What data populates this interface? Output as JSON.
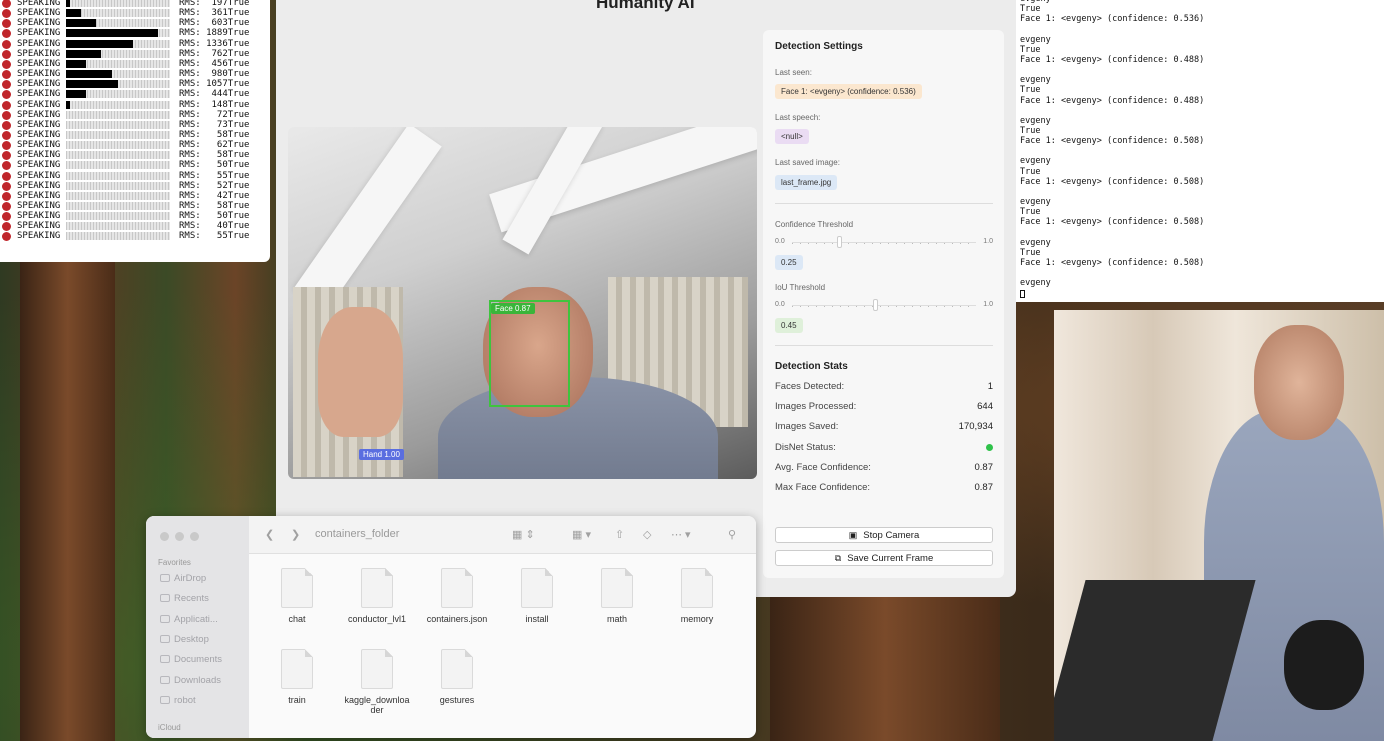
{
  "terminal_left": {
    "rows": [
      {
        "label": "SPEAKING",
        "rms": "RMS:  197True",
        "level": 0.04
      },
      {
        "label": "SPEAKING",
        "rms": "RMS:  361True",
        "level": 0.14
      },
      {
        "label": "SPEAKING",
        "rms": "RMS:  603True",
        "level": 0.29
      },
      {
        "label": "SPEAKING",
        "rms": "RMS: 1889True",
        "level": 0.88
      },
      {
        "label": "SPEAKING",
        "rms": "RMS: 1336True",
        "level": 0.64
      },
      {
        "label": "SPEAKING",
        "rms": "RMS:  762True",
        "level": 0.34
      },
      {
        "label": "SPEAKING",
        "rms": "RMS:  456True",
        "level": 0.19
      },
      {
        "label": "SPEAKING",
        "rms": "RMS:  980True",
        "level": 0.44
      },
      {
        "label": "SPEAKING",
        "rms": "RMS: 1057True",
        "level": 0.5
      },
      {
        "label": "SPEAKING",
        "rms": "RMS:  444True",
        "level": 0.19
      },
      {
        "label": "SPEAKING",
        "rms": "RMS:  148True",
        "level": 0.04
      },
      {
        "label": "SPEAKING",
        "rms": "RMS:   72True",
        "level": 0
      },
      {
        "label": "SPEAKING",
        "rms": "RMS:   73True",
        "level": 0
      },
      {
        "label": "SPEAKING",
        "rms": "RMS:   58True",
        "level": 0
      },
      {
        "label": "SPEAKING",
        "rms": "RMS:   62True",
        "level": 0
      },
      {
        "label": "SPEAKING",
        "rms": "RMS:   58True",
        "level": 0
      },
      {
        "label": "SPEAKING",
        "rms": "RMS:   50True",
        "level": 0
      },
      {
        "label": "SPEAKING",
        "rms": "RMS:   55True",
        "level": 0
      },
      {
        "label": "SPEAKING",
        "rms": "RMS:   52True",
        "level": 0
      },
      {
        "label": "SPEAKING",
        "rms": "RMS:   42True",
        "level": 0
      },
      {
        "label": "SPEAKING",
        "rms": "RMS:   58True",
        "level": 0
      },
      {
        "label": "SPEAKING",
        "rms": "RMS:   50True",
        "level": 0
      },
      {
        "label": "SPEAKING",
        "rms": "RMS:   40True",
        "level": 0
      },
      {
        "label": "SPEAKING",
        "rms": "RMS:   55True",
        "level": 0
      }
    ]
  },
  "app": {
    "title": "Humanity AI"
  },
  "video": {
    "face_label": "Face 0.87",
    "hand_label": "Hand 1.00"
  },
  "settings": {
    "heading": "Detection Settings",
    "last_seen_label": "Last seen:",
    "last_seen_value": "Face 1: <evgeny> (confidence: 0.536)",
    "last_speech_label": "Last speech:",
    "last_speech_value": "<null>",
    "last_saved_label": "Last saved image:",
    "last_saved_value": "last_frame.jpg",
    "conf_label": "Confidence Threshold",
    "conf_min": "0.0",
    "conf_max": "1.0",
    "conf_value": "0.25",
    "iou_label": "IoU Threshold",
    "iou_min": "0.0",
    "iou_max": "1.0",
    "iou_value": "0.45",
    "stats_heading": "Detection Stats",
    "stats": [
      {
        "label": "Faces Detected:",
        "value": "1"
      },
      {
        "label": "Images Processed:",
        "value": "644"
      },
      {
        "label": "Images Saved:",
        "value": "170,934"
      },
      {
        "label": "DisNet Status:",
        "value": ""
      },
      {
        "label": "Avg. Face Confidence:",
        "value": "0.87"
      },
      {
        "label": "Max Face Confidence:",
        "value": "0.87"
      }
    ],
    "stop_camera": "Stop Camera",
    "save_frame": "Save Current Frame"
  },
  "finder": {
    "title": "containers_folder",
    "favorites_heading": "Favorites",
    "sidebar": [
      "AirDrop",
      "Recents",
      "Applicati...",
      "Desktop",
      "Documents",
      "Downloads",
      "robot"
    ],
    "icloud_heading": "iCloud",
    "files": [
      "chat",
      "conductor_lvl1",
      "containers.json",
      "install",
      "math",
      "memory",
      "train",
      "kaggle_downloader",
      "gestures"
    ]
  },
  "terminal_right": {
    "lines": [
      "evgeny",
      "True",
      "Face 1: <evgeny> (confidence: 0.536)",
      "",
      "evgeny",
      "True",
      "Face 1: <evgeny> (confidence: 0.488)",
      "",
      "evgeny",
      "True",
      "Face 1: <evgeny> (confidence: 0.488)",
      "",
      "evgeny",
      "True",
      "Face 1: <evgeny> (confidence: 0.508)",
      "",
      "evgeny",
      "True",
      "Face 1: <evgeny> (confidence: 0.508)",
      "",
      "evgeny",
      "True",
      "Face 1: <evgeny> (confidence: 0.508)",
      "",
      "evgeny",
      "True",
      "Face 1: <evgeny> (confidence: 0.508)",
      "",
      "evgeny"
    ]
  }
}
